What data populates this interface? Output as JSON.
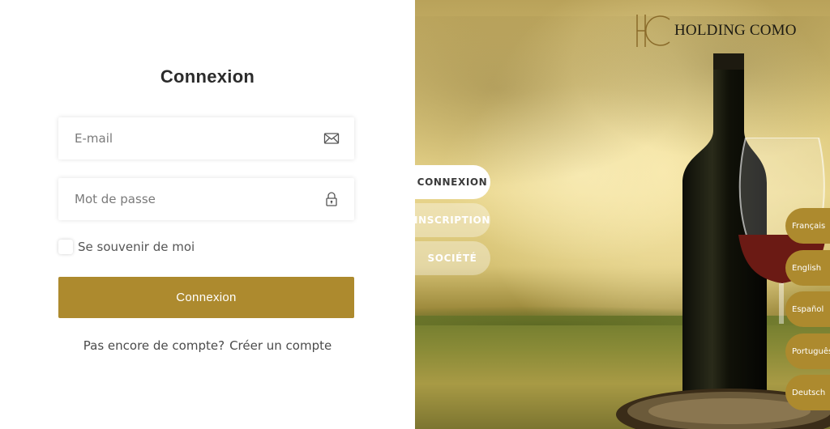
{
  "login": {
    "title": "Connexion",
    "email_placeholder": "E-mail",
    "password_placeholder": "Mot de passe",
    "remember_label": "Se souvenir de moi",
    "submit_label": "Connexion",
    "signup_prompt": "Pas encore de compte?",
    "signup_link": "Créer un compte"
  },
  "brand": {
    "name": "HOLDING COMO"
  },
  "tabs": [
    {
      "label": "CONNEXION",
      "active": true
    },
    {
      "label": "INSCRIPTION",
      "active": false
    },
    {
      "label": "SOCIÉTÉ",
      "active": false
    }
  ],
  "languages": [
    "Français",
    "English",
    "Español",
    "Português",
    "Deutsch"
  ],
  "colors": {
    "accent": "#ad8a2e",
    "text": "#2b2b2b"
  },
  "icons": {
    "email": "envelope-icon",
    "password": "lock-icon"
  }
}
